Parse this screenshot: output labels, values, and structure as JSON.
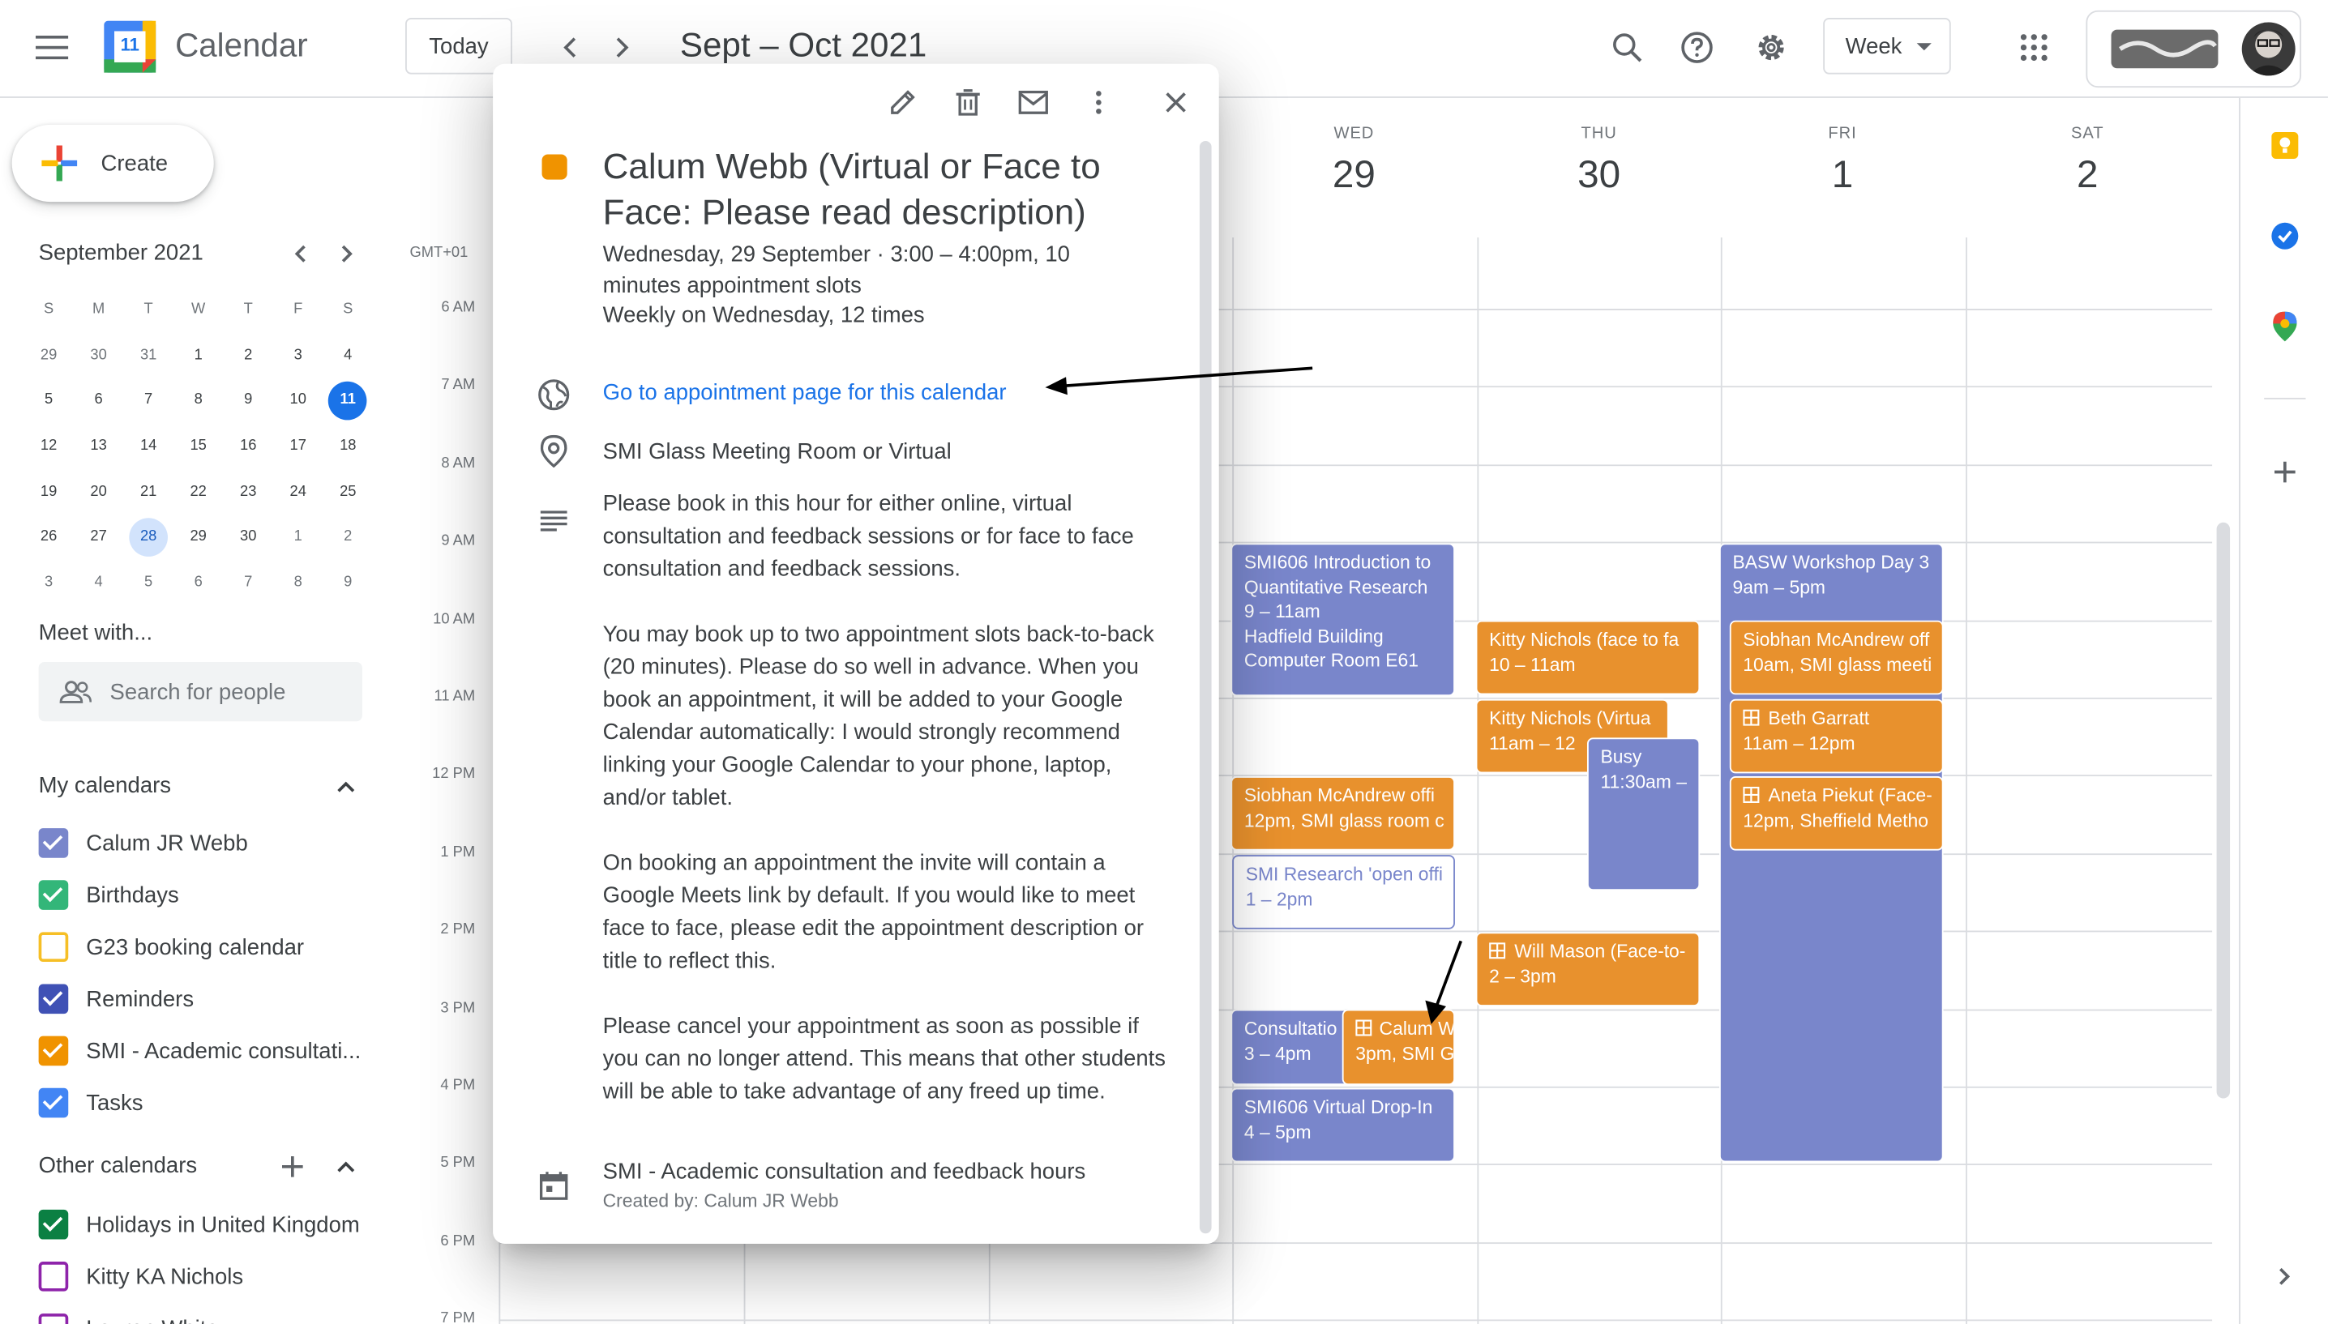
{
  "header": {
    "app_title": "Calendar",
    "logo_number": "11",
    "today_label": "Today",
    "date_range": "Sept – Oct 2021",
    "view_label": "Week"
  },
  "sidebar": {
    "create_label": "Create",
    "mini_month": "September 2021",
    "weekday_headers": [
      "S",
      "M",
      "T",
      "W",
      "T",
      "F",
      "S"
    ],
    "weeks": [
      [
        "29",
        "30",
        "31",
        "1",
        "2",
        "3",
        "4"
      ],
      [
        "5",
        "6",
        "7",
        "8",
        "9",
        "10",
        "11"
      ],
      [
        "12",
        "13",
        "14",
        "15",
        "16",
        "17",
        "18"
      ],
      [
        "19",
        "20",
        "21",
        "22",
        "23",
        "24",
        "25"
      ],
      [
        "26",
        "27",
        "28",
        "29",
        "30",
        "1",
        "2"
      ],
      [
        "3",
        "4",
        "5",
        "6",
        "7",
        "8",
        "9"
      ]
    ],
    "meet_with": "Meet with...",
    "search_people_placeholder": "Search for people",
    "my_calendars_title": "My calendars",
    "my_calendars": [
      {
        "label": "Calum JR Webb",
        "color": "#7986cb",
        "checked": true
      },
      {
        "label": "Birthdays",
        "color": "#33b679",
        "checked": true
      },
      {
        "label": "G23 booking calendar",
        "color": "#f6bf26",
        "checked": false
      },
      {
        "label": "Reminders",
        "color": "#3f51b5",
        "checked": true
      },
      {
        "label": "SMI - Academic consultati...",
        "color": "#f09300",
        "checked": true
      },
      {
        "label": "Tasks",
        "color": "#4285f4",
        "checked": true
      }
    ],
    "other_calendars_title": "Other calendars",
    "other_calendars": [
      {
        "label": "Holidays in United Kingdom",
        "color": "#0b8043",
        "checked": true
      },
      {
        "label": "Kitty KA Nichols",
        "color": "#8e24aa",
        "checked": false
      },
      {
        "label": "Lauren White",
        "color": "#8e24aa",
        "checked": false
      }
    ]
  },
  "grid": {
    "timezone": "GMT+01",
    "times": [
      "6 AM",
      "7 AM",
      "8 AM",
      "9 AM",
      "10 AM",
      "11 AM",
      "12 PM",
      "1 PM",
      "2 PM",
      "3 PM",
      "4 PM",
      "5 PM",
      "6 PM",
      "7 PM"
    ],
    "days": [
      {
        "dow": "WED",
        "num": "29"
      },
      {
        "dow": "THU",
        "num": "30"
      },
      {
        "dow": "FRI",
        "num": "1"
      },
      {
        "dow": "SAT",
        "num": "2"
      }
    ]
  },
  "events": {
    "smi606_title": "SMI606 Introduction to Quantitative Research",
    "smi606_time": "9 – 11am",
    "smi606_loc": "Hadfield Building Computer Room E61",
    "siobhan_wed_title": "Siobhan McAndrew offi",
    "siobhan_wed_time": "12pm, SMI glass room c",
    "smi_research_title": "SMI Research 'open offi",
    "smi_research_time": "1 – 2pm",
    "consult_title": "Consultatio",
    "consult_time": "3 – 4pm",
    "calum_title": "Calum W",
    "calum_time": "3pm, SMI G",
    "dropin_title": "SMI606 Virtual Drop-In",
    "dropin_time": "4 – 5pm",
    "kitty1_title": "Kitty Nichols (face to fa",
    "kitty1_time": "10 – 11am",
    "kitty2_title": "Kitty Nichols (Virtua",
    "kitty2_time": "11am – 12",
    "busy_title": "Busy",
    "busy_time": "11:30am –",
    "will_title": "Will Mason (Face-to-",
    "will_time": "2 – 3pm",
    "basw_title": "BASW Workshop Day 3",
    "basw_time": "9am – 5pm",
    "siobhan_fri_title": "Siobhan McAndrew off",
    "siobhan_fri_time": "10am, SMI glass meeti",
    "beth_title": "Beth Garratt",
    "beth_time": "11am – 12pm",
    "aneta_title": "Aneta Piekut (Face-",
    "aneta_time": "12pm, Sheffield Metho"
  },
  "popup": {
    "title": "Calum Webb (Virtual or Face to Face: Please read description)",
    "date_line": "Wednesday, 29 September  ·  3:00 – 4:00pm, 10 minutes appointment slots",
    "recurrence": "Weekly on Wednesday, 12 times",
    "appointment_link": "Go to appointment page for this calendar",
    "location": "SMI Glass Meeting Room or Virtual",
    "desc_1": "Please book in this hour for either online, virtual consultation and feedback sessions or for face to face consultation and feedback sessions.",
    "desc_2": "You may book up to two appointment slots back-to-back (20 minutes). Please do so well in advance. When you book an appointment, it will be added to your Google Calendar automatically: I would strongly recommend linking your Google Calendar to your phone, laptop, and/or tablet.",
    "desc_3": "On booking an appointment the invite will contain a Google Meets link by default. If you would like to meet face to face, please edit the appointment description or title to reflect this.",
    "desc_4": "Please cancel your appointment as soon as possible if you can no longer attend. This means that other students will be able to take advantage of any freed up time.",
    "calendar_name": "SMI - Academic consultation and feedback hours",
    "created_by": "Created by: Calum JR Webb",
    "event_color": "#f09300"
  },
  "colors": {
    "lavender": "#7986cb",
    "tangerine": "#e8912d",
    "accent": "#1a73e8"
  }
}
